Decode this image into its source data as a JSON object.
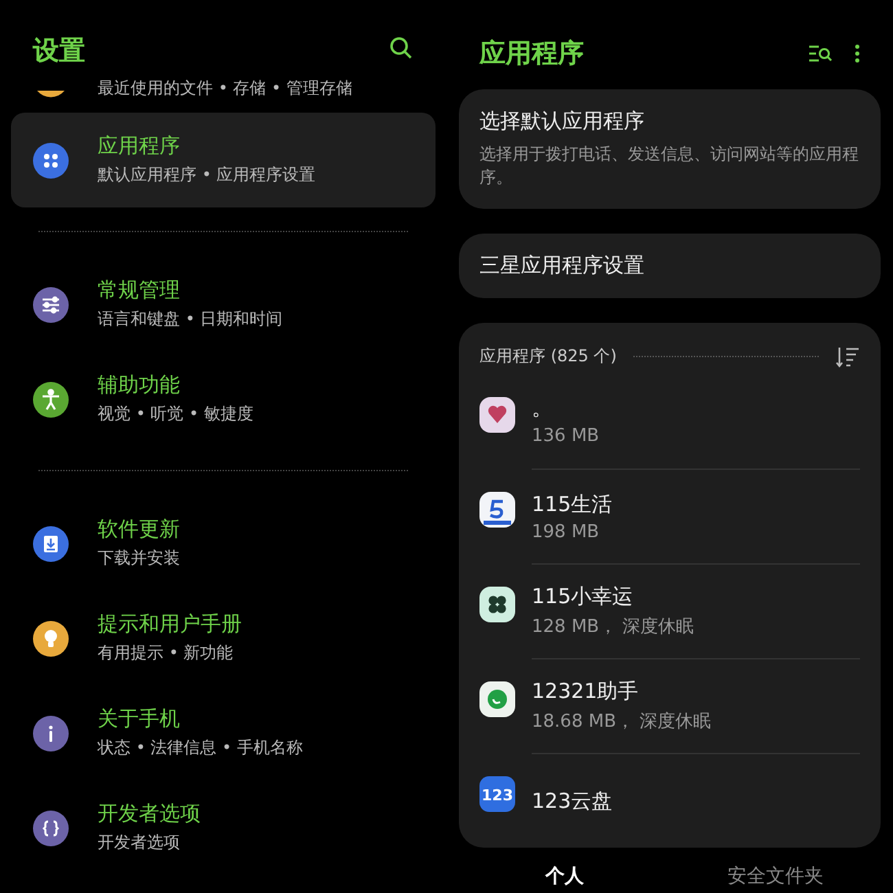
{
  "left": {
    "title": "设置",
    "partial_row": {
      "subtitle": "最近使用的文件 • 存储 • 管理存储",
      "color": "#e8a93c"
    },
    "groups": [
      {
        "items": [
          {
            "title": "应用程序",
            "subtitle": "默认应用程序 • 应用程序设置",
            "kind": "apps",
            "color": "#3b6fe0",
            "selected": true
          }
        ]
      },
      {
        "items": [
          {
            "title": "常规管理",
            "subtitle": "语言和键盘 • 日期和时间",
            "kind": "sliders",
            "color": "#6c63a8",
            "selected": false
          },
          {
            "title": "辅助功能",
            "subtitle": "视觉 • 听觉 • 敏捷度",
            "kind": "person",
            "color": "#5aa832",
            "selected": false
          }
        ]
      },
      {
        "items": [
          {
            "title": "软件更新",
            "subtitle": "下载并安装",
            "kind": "download",
            "color": "#3b6fe0",
            "selected": false
          },
          {
            "title": "提示和用户手册",
            "subtitle": "有用提示 • 新功能",
            "kind": "bulb",
            "color": "#e8a93c",
            "selected": false
          },
          {
            "title": "关于手机",
            "subtitle": "状态 • 法律信息 • 手机名称",
            "kind": "info",
            "color": "#6c63a8",
            "selected": false
          },
          {
            "title": "开发者选项",
            "subtitle": "开发者选项",
            "kind": "braces",
            "color": "#6c63a8",
            "selected": false
          }
        ]
      }
    ]
  },
  "right": {
    "title": "应用程序",
    "cards": [
      {
        "title": "选择默认应用程序",
        "description": "选择用于拨打电话、发送信息、访问网站等的应用程序。"
      },
      {
        "title": "三星应用程序设置"
      }
    ],
    "list_header": "应用程序 (825 个)",
    "apps": [
      {
        "name": "。",
        "size": "136 MB",
        "kind": "heart"
      },
      {
        "name": "115生活",
        "size": "198 MB",
        "kind": "swoosh"
      },
      {
        "name": "115小幸运",
        "size": "128 MB， 深度休眠",
        "kind": "clover"
      },
      {
        "name": "12321助手",
        "size": "18.68 MB， 深度休眠",
        "kind": "check"
      },
      {
        "name": "123云盘",
        "kind": "text",
        "icon_text": "123"
      }
    ]
  },
  "bottom_tabs": [
    {
      "label": "个人",
      "selected": true
    },
    {
      "label": "安全文件夹",
      "selected": false
    }
  ]
}
